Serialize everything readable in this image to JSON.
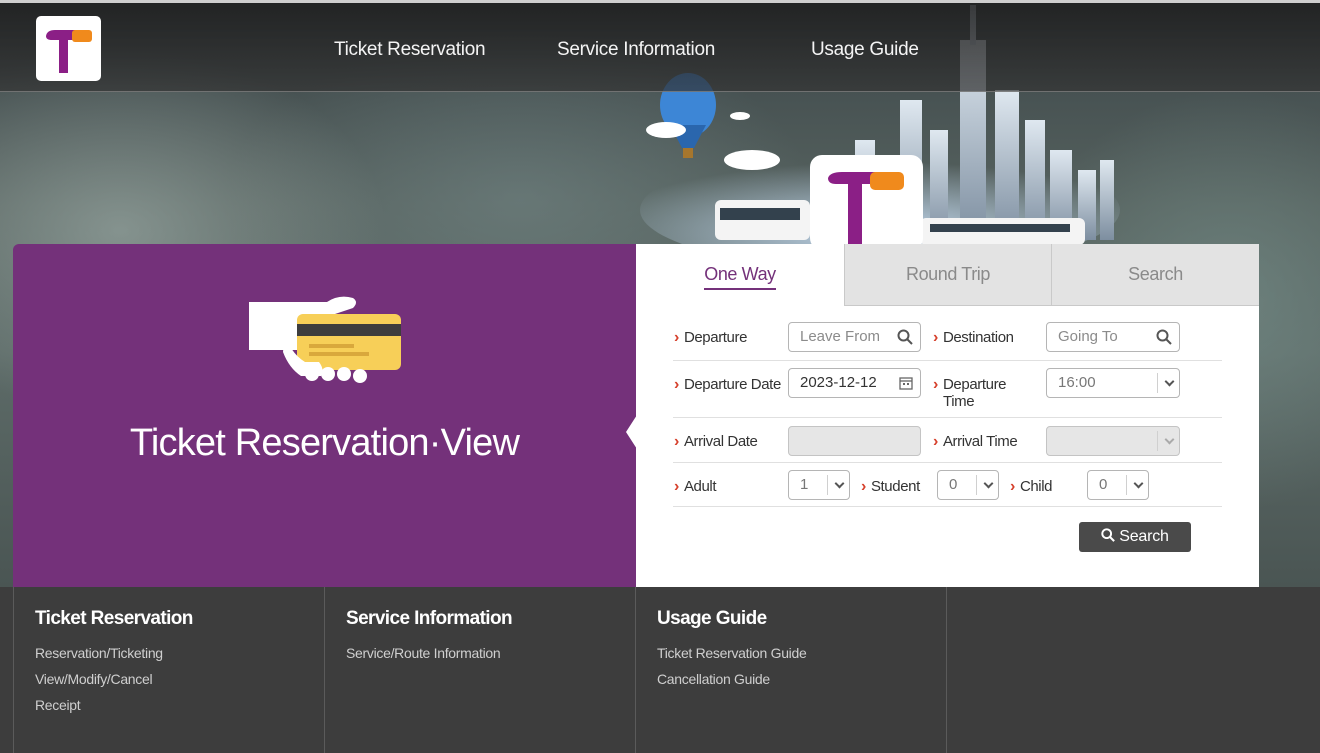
{
  "nav": {
    "items": [
      {
        "label": "Ticket Reservation"
      },
      {
        "label": "Service Information"
      },
      {
        "label": "Usage Guide"
      }
    ]
  },
  "hero": {
    "title": "Ticket Reservation·View"
  },
  "tabs": [
    {
      "label": "One Way",
      "active": true
    },
    {
      "label": "Round Trip",
      "active": false
    },
    {
      "label": "Search",
      "active": false
    }
  ],
  "form": {
    "departure_label": "Departure",
    "departure_placeholder": "Leave From",
    "destination_label": "Destination",
    "destination_placeholder": "Going To",
    "departure_date_label": "Departure Date",
    "departure_date_value": "2023-12-12",
    "departure_time_label_1": "Departure",
    "departure_time_label_2": "Time",
    "departure_time_value": "16:00",
    "arrival_date_label": "Arrival Date",
    "arrival_time_label": "Arrival Time",
    "adult_label": "Adult",
    "adult_value": "1",
    "student_label": "Student",
    "student_value": "0",
    "child_label": "Child",
    "child_value": "0",
    "search_button": "Search"
  },
  "footer": {
    "columns": [
      {
        "title": "Ticket Reservation",
        "links": [
          "Reservation/Ticketing",
          "View/Modify/Cancel",
          "Receipt"
        ]
      },
      {
        "title": "Service Information",
        "links": [
          "Service/Route Information"
        ]
      },
      {
        "title": "Usage Guide",
        "links": [
          "Ticket Reservation Guide",
          "Cancellation Guide"
        ]
      }
    ]
  },
  "colors": {
    "brand_purple": "#74317a",
    "brand_orange": "#f08a1c",
    "accent_red": "#d6402c"
  }
}
